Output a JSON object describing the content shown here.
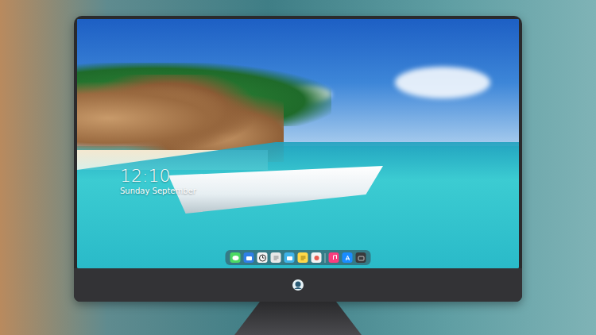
{
  "lock_screen": {
    "time": "12:10",
    "date": "Sunday September"
  },
  "dock": {
    "items": [
      {
        "kind": "messages"
      },
      {
        "kind": "files"
      },
      {
        "kind": "clock"
      },
      {
        "kind": "notes"
      },
      {
        "kind": "folder"
      },
      {
        "kind": "memo"
      },
      {
        "kind": "photos"
      },
      {
        "kind": "separator"
      },
      {
        "kind": "music"
      },
      {
        "kind": "store"
      },
      {
        "kind": "camera"
      }
    ]
  }
}
